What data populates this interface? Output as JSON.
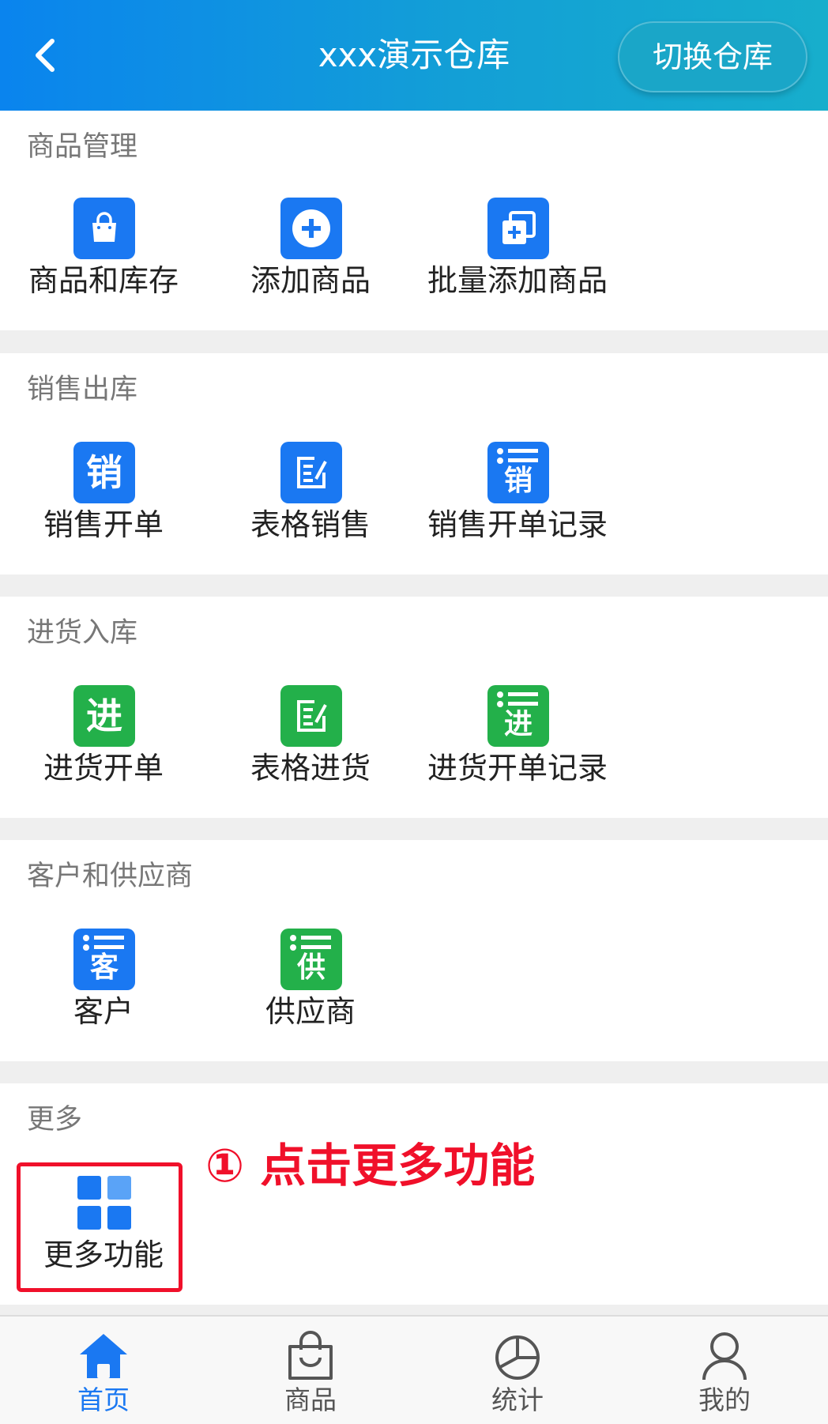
{
  "header": {
    "title": "xxx演示仓库",
    "switch_label": "切换仓库"
  },
  "sections": [
    {
      "title": "商品管理",
      "items": [
        {
          "label": "商品和库存",
          "icon": "shopping-bag-icon"
        },
        {
          "label": "添加商品",
          "icon": "plus-circle-icon"
        },
        {
          "label": "批量添加商品",
          "icon": "batch-add-icon"
        }
      ]
    },
    {
      "title": "销售出库",
      "items": [
        {
          "label": "销售开单",
          "icon": "sales-order-icon",
          "glyph": "销"
        },
        {
          "label": "表格销售",
          "icon": "table-edit-icon"
        },
        {
          "label": "销售开单记录",
          "icon": "sales-record-icon",
          "glyph": "销"
        }
      ]
    },
    {
      "title": "进货入库",
      "items": [
        {
          "label": "进货开单",
          "icon": "purchase-order-icon",
          "glyph": "进"
        },
        {
          "label": "表格进货",
          "icon": "table-edit-icon"
        },
        {
          "label": "进货开单记录",
          "icon": "purchase-record-icon",
          "glyph": "进"
        }
      ]
    },
    {
      "title": "客户和供应商",
      "items": [
        {
          "label": "客户",
          "icon": "customer-icon",
          "glyph": "客"
        },
        {
          "label": "供应商",
          "icon": "supplier-icon",
          "glyph": "供"
        }
      ]
    },
    {
      "title": "更多",
      "items": [
        {
          "label": "更多功能",
          "icon": "grid-icon"
        }
      ]
    }
  ],
  "annotation": "① 点击更多功能",
  "tabs": [
    {
      "label": "首页",
      "icon": "home-icon",
      "active": true
    },
    {
      "label": "商品",
      "icon": "bag-icon",
      "active": false
    },
    {
      "label": "统计",
      "icon": "pie-chart-icon",
      "active": false
    },
    {
      "label": "我的",
      "icon": "user-icon",
      "active": false
    }
  ],
  "colors": {
    "header_start": "#0a84ee",
    "header_end": "#17aecc",
    "accent_blue": "#1a78f2",
    "accent_green": "#23b04a",
    "annotation_red": "#f0102a"
  }
}
